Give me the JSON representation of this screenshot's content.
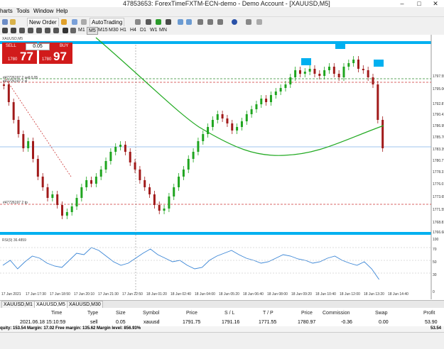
{
  "window": {
    "title": "47853653: ForexTimeFXTM-ECN-demo - Demo Account - [XAUUSD,M5]",
    "controls": [
      "–",
      "□",
      "✕"
    ]
  },
  "menu": [
    "harts",
    "Tools",
    "Window",
    "Help"
  ],
  "toolbar": {
    "new_order_label": "New Order",
    "autotrading_label": "AutoTrading",
    "timeframes": [
      "M1",
      "M5",
      "M15",
      "M30",
      "H1",
      "H4",
      "D1",
      "W1",
      "MN"
    ],
    "active_timeframe": "M5"
  },
  "chart": {
    "symbol_title": "XAUUSD,M5",
    "one_click": {
      "sell_label": "SELL",
      "buy_label": "BUY",
      "lot": "0.05",
      "sell_small": "1780",
      "sell_big": "77",
      "buy_small": "1780",
      "buy_big": "97"
    },
    "price_labels": [
      "1797.55",
      "1795.06",
      "1792.87",
      "1790.41",
      "1786.95",
      "1785.78",
      "1783.39",
      "1780.77",
      "1778.31",
      "1776.01",
      "1773.65",
      "1771.55",
      "1768.81",
      "1766.68"
    ],
    "current_price": "1780.77",
    "time_labels": [
      "17 Jun 2021",
      "17 Jun 17:30",
      "17 Jun 18:50",
      "17 Jun 20:10",
      "17 Jun 21:30",
      "17 Jun 22:50",
      "18 Jun 01:20",
      "18 Jun 02:40",
      "18 Jun 04:00",
      "18 Jun 05:20",
      "18 Jun 06:40",
      "18 Jun 08:00",
      "18 Jun 09:20",
      "18 Jun 10:40",
      "18 Jun 12:00",
      "18 Jun 13:20",
      "18 Jun 14:40"
    ],
    "order_line_label_1": "#47726197 2 sell 0.05",
    "order_line_label_2": "#47726197 2 sl",
    "order_line_label_3": "#47726197 2 tp",
    "indicator_label": "RSI(9) 36.4859",
    "indicator_levels": [
      "100",
      "70",
      "50",
      "30",
      "0"
    ],
    "colors": {
      "bull": "#1fa51f",
      "bear": "#a11a1a",
      "ma": "#22aa22",
      "hline": "#00b0f0",
      "rsi": "#3b86d6",
      "order": "#cc3333",
      "tp_line": "#2e8b2e"
    }
  },
  "tabs": [
    "XAUUSD,M1",
    "XAUUSD,M5",
    "XAUUSD,M30"
  ],
  "active_tab": "XAUUSD,M5",
  "terminal": {
    "headers": [
      "Time",
      "Type",
      "Size",
      "Symbol",
      "Price",
      "S / L",
      "T / P",
      "Price",
      "Commission",
      "Swap",
      "Profit"
    ],
    "row": {
      "time": "2021.06.18 15:10:59",
      "type": "sell",
      "size": "0.05",
      "symbol": "xauusd",
      "price": "1791.75",
      "sl": "1791.16",
      "tp": "1771.55",
      "cur_price": "1780.97",
      "commission": "-0.36",
      "swap": "0.00",
      "profit": "53.90"
    },
    "status": "quity: 153.54  Margin: 17.02  Free margin: 135.62  Margin level: 856.93%",
    "status_total": "53.54"
  }
}
